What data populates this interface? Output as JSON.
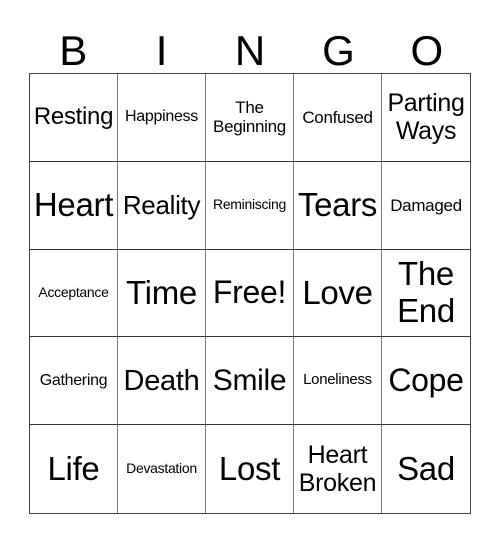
{
  "header": [
    "B",
    "I",
    "N",
    "G",
    "O"
  ],
  "cells": [
    "Resting",
    "Happiness",
    "The\nBeginning",
    "Confused",
    "Parting\nWays",
    "Heart",
    "Reality",
    "Reminiscing",
    "Tears",
    "Damaged",
    "Acceptance",
    "Time",
    "Free!",
    "Love",
    "The\nEnd",
    "Gathering",
    "Death",
    "Smile",
    "Loneliness",
    "Cope",
    "Life",
    "Devastation",
    "Lost",
    "Heart\nBroken",
    "Sad"
  ]
}
